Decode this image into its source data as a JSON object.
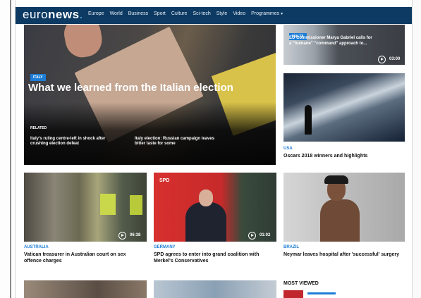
{
  "header": {
    "logo_a": "euro",
    "logo_b": "news",
    "logo_dot": ".",
    "nav": [
      "Europe",
      "World",
      "Business",
      "Sport",
      "Culture",
      "Sci-tech",
      "Style",
      "Video",
      "Programmes"
    ],
    "nav_caret": "▾"
  },
  "hero": {
    "tag": "Italy",
    "title": "What we learned from the Italian election",
    "related_label": "RELATED",
    "related": [
      "Italy's ruling centre-left in shock after crushing election defeat",
      "Italy election: Russian campaign leaves bitter taste for some"
    ]
  },
  "right_top": {
    "tag": "Malta",
    "title": "EU Commissioner Marya Gabriel calls for a \"humane\" \"command\" approach to...",
    "duration": "03:00"
  },
  "oscars": {
    "category": "USA",
    "title": "Oscars 2018 winners and highlights"
  },
  "row2": [
    {
      "category": "Australia",
      "title": "Vatican treasurer in Australian court on sex offence charges",
      "duration": "06:38"
    },
    {
      "category": "Germany",
      "title": "SPD agrees to enter into grand coalition with Merkel's Conservatives",
      "duration": "01:02",
      "image_text": "SPD"
    },
    {
      "category": "Brazil",
      "title": "Neymar leaves hospital after 'successful' surgery"
    }
  ],
  "most_viewed": {
    "title": "MOST VIEWED"
  }
}
